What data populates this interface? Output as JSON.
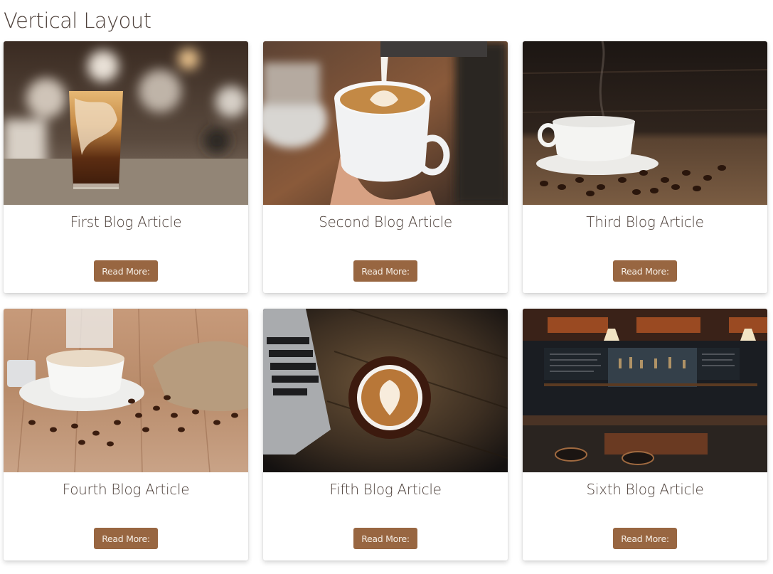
{
  "page": {
    "title": "Vertical Layout"
  },
  "colors": {
    "button_bg": "#986641",
    "button_text": "#f5ede4",
    "title_text": "#4b3e38"
  },
  "cards": [
    {
      "title": "First Blog Article",
      "button_label": "Read More:",
      "image": "iced-coffee-glass"
    },
    {
      "title": "Second Blog Article",
      "button_label": "Read More:",
      "image": "latte-art-pour"
    },
    {
      "title": "Third Blog Article",
      "button_label": "Read More:",
      "image": "coffee-cup-with-beans"
    },
    {
      "title": "Fourth Blog Article",
      "button_label": "Read More:",
      "image": "coffee-cup-burlap-sack"
    },
    {
      "title": "Fifth Blog Article",
      "button_label": "Read More:",
      "image": "latte-laptop-table"
    },
    {
      "title": "Sixth Blog Article",
      "button_label": "Read More:",
      "image": "coffee-bar-interior"
    }
  ]
}
